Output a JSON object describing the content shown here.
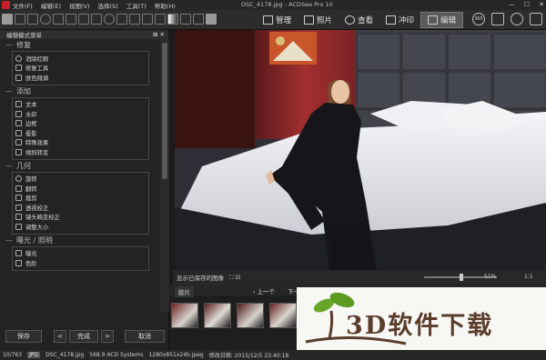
{
  "menubar": {
    "items": [
      "文件(F)",
      "编辑(E)",
      "视图(V)",
      "选择(S)",
      "工具(T)",
      "帮助(H)"
    ],
    "title": "DSC_4178.jpg - ACDSee Pro 10"
  },
  "modes": [
    {
      "label": "管理",
      "icon": "manage-icon"
    },
    {
      "label": "照片",
      "icon": "photos-icon"
    },
    {
      "label": "查看",
      "icon": "view-icon"
    },
    {
      "label": "冲印",
      "icon": "develop-icon"
    },
    {
      "label": "编辑",
      "icon": "edit-icon",
      "active": true
    }
  ],
  "right_toolbar": {
    "badge": "365"
  },
  "panel": {
    "title": "编辑模式菜单",
    "groups": [
      {
        "label": "修复",
        "items": [
          "消除红眼",
          "修复工具",
          "肤色微调"
        ]
      },
      {
        "label": "添加",
        "items": [
          "文本",
          "水印",
          "边框",
          "晕影",
          "特殊效果",
          "倾斜转变"
        ]
      },
      {
        "label": "几何",
        "items": [
          "旋转",
          "翻转",
          "裁剪",
          "透视校正",
          "镜头畸变校正",
          "调整大小"
        ]
      },
      {
        "label": "曝光 / 照明",
        "items": [
          "曝光",
          "色阶"
        ]
      }
    ]
  },
  "footer": {
    "save": "保存",
    "done": "完成",
    "cancel": "取消",
    "prev": "<",
    "next": ">"
  },
  "image_status": {
    "show_saved": "显示已保存的图像",
    "zoom": "51%",
    "ratio": "1:1",
    "zoom_fraction": 0.51
  },
  "filmstrip": {
    "tab": "胶片",
    "prev": "上一个",
    "next": "下一个"
  },
  "watermark": {
    "text": "3D软件下载"
  },
  "statusbar": {
    "count": "10/763",
    "format": "JPG",
    "file": "DSC_4178.jpg",
    "size": "568.9 ACD Systems",
    "dims": "1280x851x24b.jpeg",
    "modified": "修改日期: 2015/12/5 23:40:18"
  }
}
